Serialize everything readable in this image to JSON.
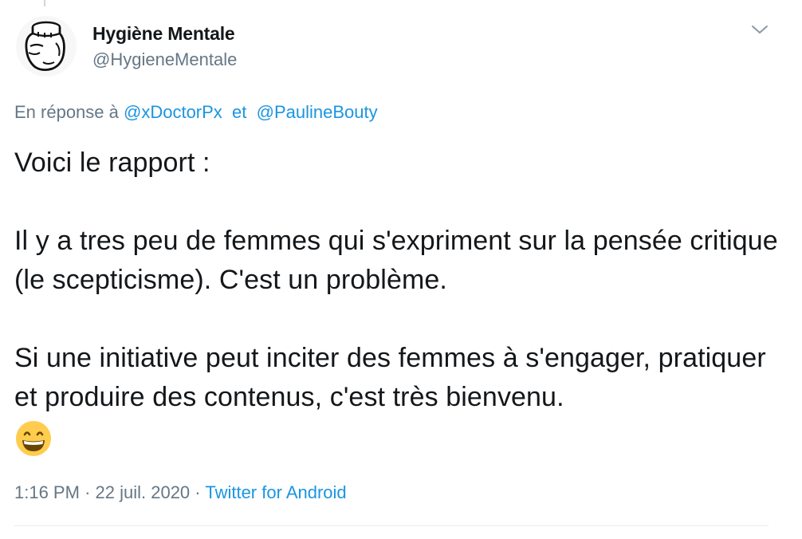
{
  "author": {
    "name": "Hygiène Mentale",
    "handle": "@HygieneMentale"
  },
  "reply": {
    "prefix": "En réponse à",
    "mention_1": "@xDoctorPx",
    "conjunction": "et",
    "mention_2": "@PaulineBouty"
  },
  "tweet": {
    "text": "Voici le rapport :\n\nIl y a tres peu de femmes qui s'expriment sur la pensée critique (le scepticisme). C'est un problème.\n\nSi une initiative peut inciter des femmes à s'engager, pratiquer et produire des contenus, c'est très bienvenu.",
    "emoji": "grinning-face-with-smiling-eyes"
  },
  "meta": {
    "time": "1:16 PM",
    "separator": "·",
    "date": "22 juil. 2020",
    "source": "Twitter for Android"
  },
  "icons": {
    "menu": "chevron-down-icon"
  },
  "colors": {
    "link": "#1b95e0",
    "secondary_text": "#657786",
    "primary_text": "#14171a",
    "divider": "#e6ecf0",
    "emoji_face": "#ffcc4d"
  }
}
